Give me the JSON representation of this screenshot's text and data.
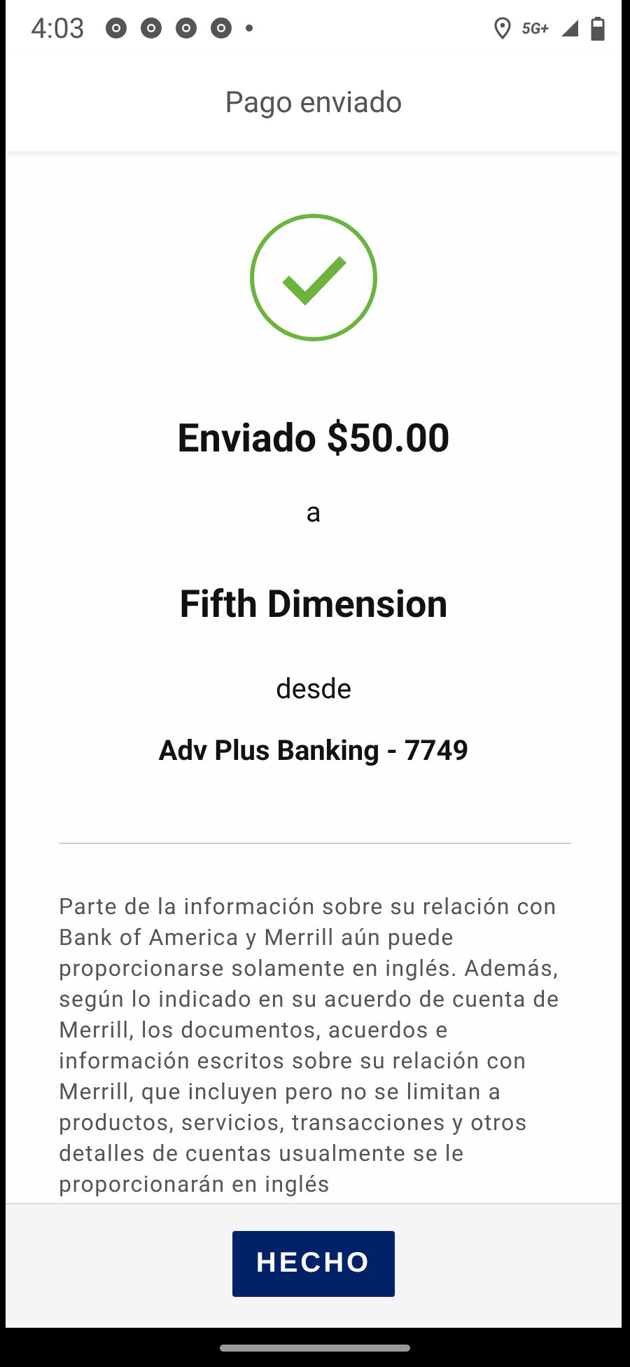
{
  "status_bar": {
    "time": "4:03",
    "notifications": [
      {
        "kind": "browser"
      },
      {
        "kind": "browser"
      },
      {
        "kind": "browser"
      },
      {
        "kind": "browser"
      },
      {
        "kind": "more"
      }
    ],
    "network": "5G+"
  },
  "header": {
    "title": "Pago enviado"
  },
  "confirmation": {
    "succeeded": true,
    "amount_line": "Enviado $50.00",
    "to_word": "a",
    "recipient": "Fifth Dimension",
    "from_word": "desde",
    "account": "Adv Plus Banking - 7749"
  },
  "disclaimer": "Parte de la información sobre su relación con Bank of America y Merrill aún puede proporcionarse solamente en inglés. Además, según lo indicado en su acuerdo de cuenta de Merrill, los documentos, acuerdos e información escritos sobre su relación con Merrill, que incluyen pero no se limitan a productos, servicios, transacciones y otros detalles de cuentas usualmente se le proporcionarán en inglés",
  "footer": {
    "button": "HECHO"
  }
}
